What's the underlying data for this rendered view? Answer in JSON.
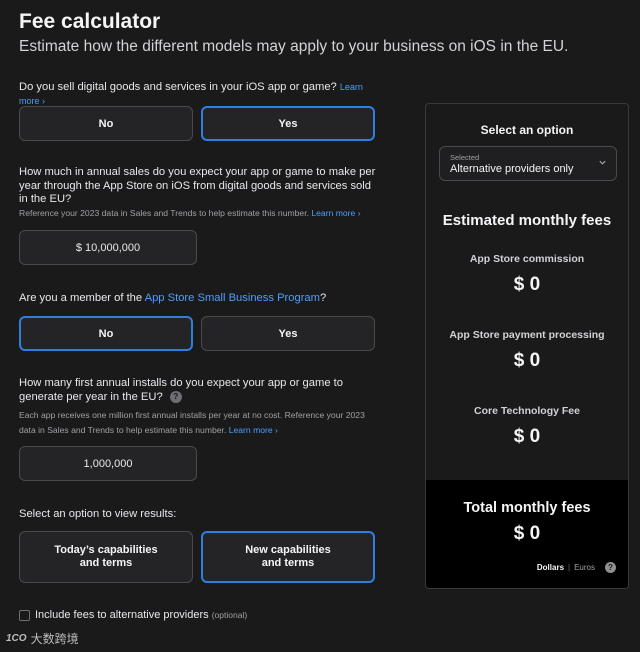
{
  "header": {
    "title": "Fee calculator",
    "subtitle": "Estimate how the different models may apply to your business on iOS in the EU."
  },
  "q1": {
    "text": "Do you sell digital goods and services in your iOS app or game?",
    "learn_more": "Learn more ›",
    "no": "No",
    "yes": "Yes"
  },
  "q2": {
    "text": "How much in annual sales do you expect your app or game to make per year through the App Store on iOS from digital goods and services sold in the EU?",
    "hint": "Reference your 2023 data in Sales and Trends to help estimate this number.",
    "learn_more": "Learn more ›",
    "value": "$ 10,000,000"
  },
  "q3": {
    "text_before": "Are you a member of the ",
    "link": "App Store Small Business Program",
    "text_after": "?",
    "no": "No",
    "yes": "Yes"
  },
  "q4": {
    "text": "How many first annual installs do you expect your app or game to generate per year in the EU?",
    "help": "?",
    "hint": "Each app receives one million first annual installs per year at no cost. Reference your 2023 data in Sales and Trends to help estimate this number.",
    "learn_more": "Learn more ›",
    "value": "1,000,000"
  },
  "results": {
    "prompt": "Select an option to view results:",
    "option1_line1": "Today’s capabilities",
    "option1_line2": "and terms",
    "option2_line1": "New capabilities",
    "option2_line2": "and terms"
  },
  "checkbox": {
    "label": "Include fees to alternative providers",
    "optional": "(optional)"
  },
  "panel": {
    "select_heading": "Select an option",
    "select_small": "Selected",
    "select_value": "Alternative providers only",
    "estimated_title": "Estimated monthly fees",
    "fees": [
      {
        "label": "App Store commission",
        "value": "$ 0"
      },
      {
        "label": "App Store payment processing",
        "value": "$ 0"
      },
      {
        "label": "Core Technology Fee",
        "value": "$ 0"
      }
    ],
    "total_label": "Total monthly fees",
    "total_value": "$ 0",
    "currency_dollars": "Dollars",
    "currency_sep": "|",
    "currency_euros": "Euros",
    "help": "?"
  },
  "watermark": {
    "mark": "1CO",
    "text": "大数跨境"
  },
  "colors": {
    "background": "#1a1a1b",
    "accent": "#2f7fe0",
    "link": "#4c9ffe",
    "total_background": "#000000"
  }
}
